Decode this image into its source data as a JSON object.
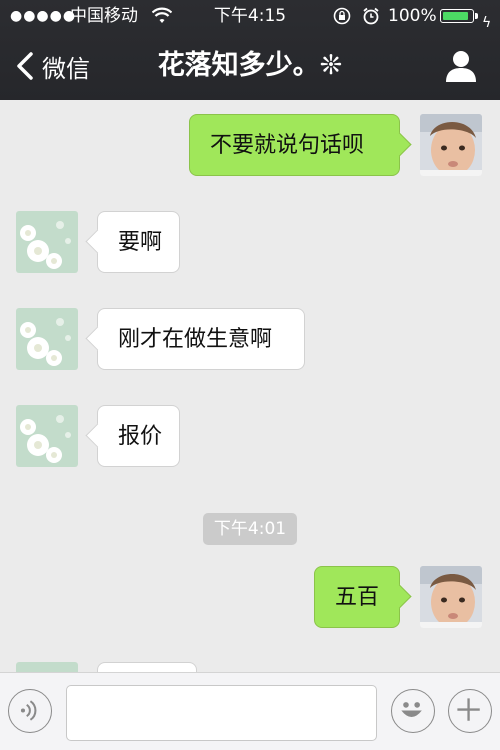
{
  "status_bar": {
    "signal": "●●●●●",
    "carrier": "中国移动",
    "time": "下午4:15",
    "battery_percent": "100%",
    "battery_level": 1.0,
    "battery_color": "#4cd964"
  },
  "nav": {
    "back_label": "微信",
    "title": "花落知多少。❊",
    "back_icon": "chevron-left-icon",
    "profile_icon": "person-icon"
  },
  "messages": [
    {
      "side": "out",
      "text": "不要就说句话呗",
      "avatar": "child-avatar"
    },
    {
      "side": "in",
      "text": "要啊",
      "avatar": "daisy-avatar"
    },
    {
      "side": "in",
      "text": "刚才在做生意啊",
      "avatar": "daisy-avatar"
    },
    {
      "side": "in",
      "text": "报价",
      "avatar": "daisy-avatar"
    },
    {
      "side": "out",
      "text": "五百",
      "avatar": "child-avatar"
    }
  ],
  "timestamp": "下午4:01",
  "input_bar": {
    "value": "",
    "voice_icon": "voice-icon",
    "emoji_icon": "emoji-icon",
    "plus_icon": "plus-icon"
  },
  "colors": {
    "header_bg": "#2c2d31",
    "chat_bg": "#ebebeb",
    "outgoing_bubble": "#a0e75a",
    "incoming_bubble": "#ffffff"
  }
}
